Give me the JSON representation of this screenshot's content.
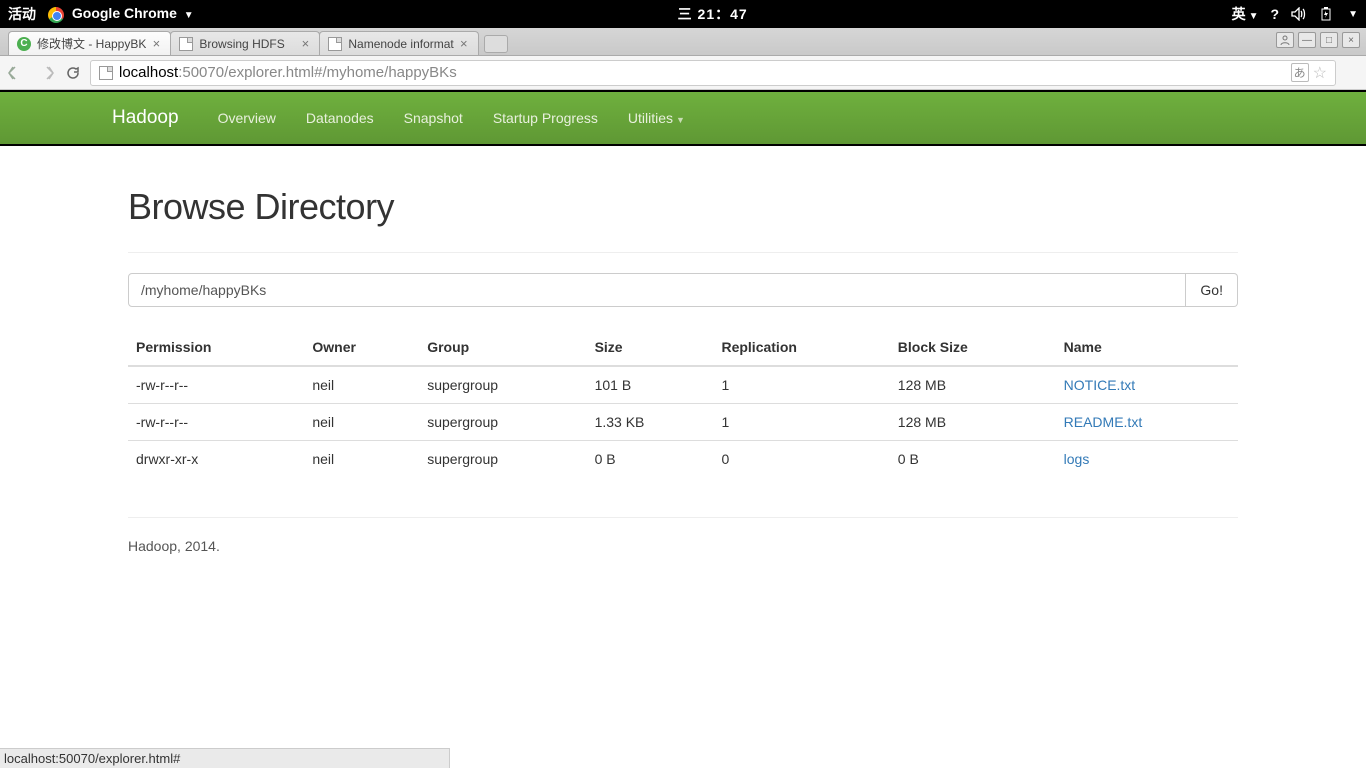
{
  "gnome": {
    "activities": "活动",
    "app": "Google Chrome",
    "clock": "三 21：47",
    "ime": "英"
  },
  "tabs": [
    {
      "title": "修改博文 - HappyBK",
      "favicon": "c"
    },
    {
      "title": "Browsing HDFS",
      "favicon": "page"
    },
    {
      "title": "Namenode informat",
      "favicon": "page"
    }
  ],
  "url": {
    "host": "localhost",
    "rest": ":50070/explorer.html#/myhome/happyBKs"
  },
  "nav": {
    "brand": "Hadoop",
    "items": [
      "Overview",
      "Datanodes",
      "Snapshot",
      "Startup Progress",
      "Utilities"
    ]
  },
  "page": {
    "title": "Browse Directory",
    "path_value": "/myhome/happyBKs",
    "go_label": "Go!",
    "columns": [
      "Permission",
      "Owner",
      "Group",
      "Size",
      "Replication",
      "Block Size",
      "Name"
    ],
    "rows": [
      {
        "perm": "-rw-r--r--",
        "owner": "neil",
        "group": "supergroup",
        "size": "101 B",
        "repl": "1",
        "block": "128 MB",
        "name": "NOTICE.txt"
      },
      {
        "perm": "-rw-r--r--",
        "owner": "neil",
        "group": "supergroup",
        "size": "1.33 KB",
        "repl": "1",
        "block": "128 MB",
        "name": "README.txt"
      },
      {
        "perm": "drwxr-xr-x",
        "owner": "neil",
        "group": "supergroup",
        "size": "0 B",
        "repl": "0",
        "block": "0 B",
        "name": "logs"
      }
    ],
    "footer": "Hadoop, 2014."
  },
  "status": "localhost:50070/explorer.html#"
}
